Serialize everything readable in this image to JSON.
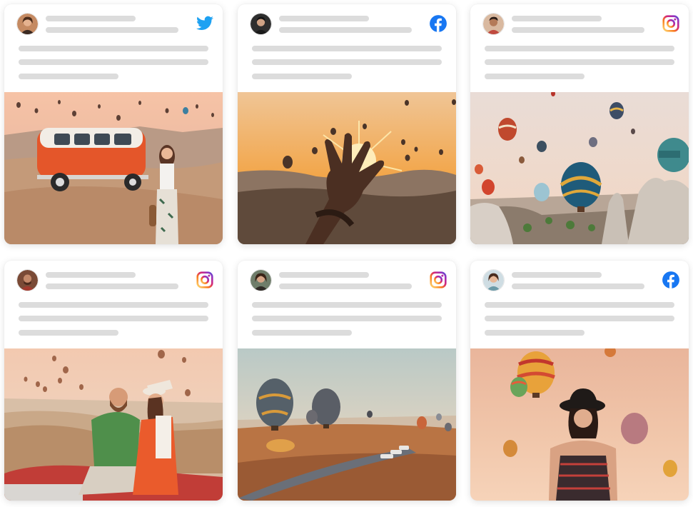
{
  "feed": {
    "cards": [
      {
        "network": "twitter-icon",
        "accent": "#1da1f2",
        "photo": "photo-van-and-woman"
      },
      {
        "network": "facebook-icon",
        "accent": "#1877f2",
        "photo": "photo-hand-sunset"
      },
      {
        "network": "instagram-icon",
        "accent": "#c13584",
        "photo": "photo-balloons-rocks"
      },
      {
        "network": "instagram-icon",
        "accent": "#c13584",
        "photo": "photo-couple"
      },
      {
        "network": "instagram-icon",
        "accent": "#c13584",
        "photo": "photo-balloons-field"
      },
      {
        "network": "facebook-icon",
        "accent": "#1877f2",
        "photo": "photo-woman-hat"
      }
    ],
    "placeholder_color": "#dcdcdc"
  }
}
